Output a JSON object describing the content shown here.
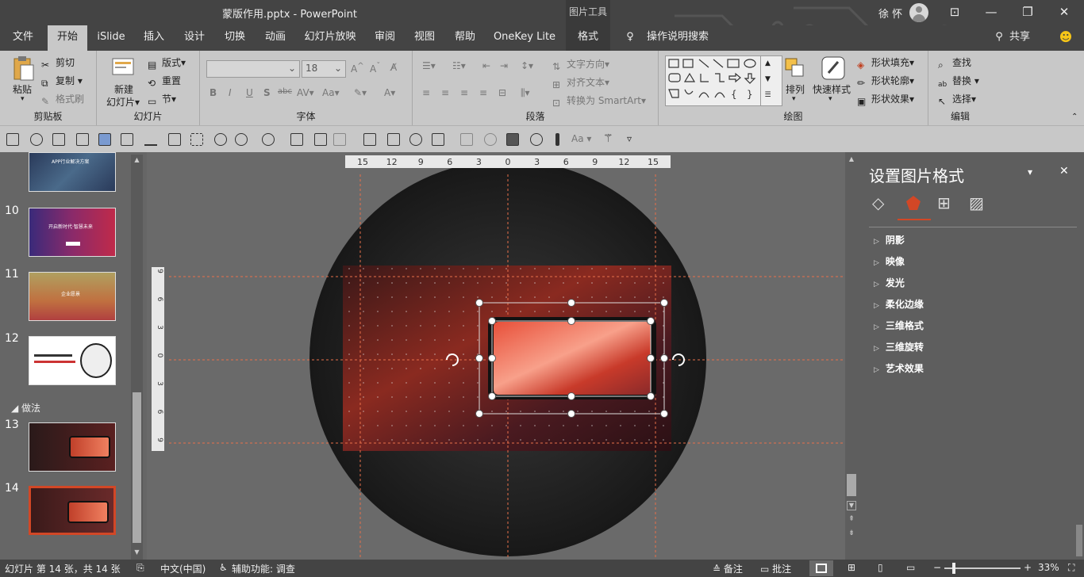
{
  "titlebar": {
    "title": "蒙版作用.pptx  -  PowerPoint",
    "context_tools": "图片工具",
    "user": "徐 怀",
    "restore_icon": "ribbon-display-options-icon",
    "minimize": "—",
    "maximize": "❐",
    "close": "✕"
  },
  "tabs": [
    "文件",
    "开始",
    "iSlide",
    "插入",
    "设计",
    "切换",
    "动画",
    "幻灯片放映",
    "审阅",
    "视图",
    "帮助",
    "OneKey Lite",
    "格式"
  ],
  "tell_me": "操作说明搜索",
  "share": "共享",
  "ribbon": {
    "clipboard": {
      "paste": "粘贴",
      "cut": "剪切",
      "copy": "复制",
      "format_painter": "格式刷",
      "label": "剪贴板"
    },
    "slides": {
      "new_slide_1": "新建",
      "new_slide_2": "幻灯片",
      "layout": "版式",
      "reset": "重置",
      "section": "节",
      "label": "幻灯片"
    },
    "font": {
      "font_name": "",
      "font_size": "18",
      "label": "字体"
    },
    "paragraph": {
      "text_direction": "文字方向",
      "align_text": "对齐文本",
      "convert_smartart": "转换为 SmartArt",
      "label": "段落"
    },
    "drawing": {
      "arrange": "排列",
      "quick_styles": "快速样式",
      "shape_fill": "形状填充",
      "shape_outline": "形状轮廓",
      "shape_effects": "形状效果",
      "label": "绘图"
    },
    "editing": {
      "find": "查找",
      "replace": "替换",
      "select": "选择",
      "label": "编辑"
    }
  },
  "slides_panel": {
    "numbers": [
      "10",
      "11",
      "12",
      "13",
      "14"
    ],
    "section": "做法",
    "thumb_texts": {
      "t9": "APP行业解决方案",
      "t10": "开启新时代·智慧未来",
      "t11": "企业愿景"
    }
  },
  "ruler": {
    "h_ticks": [
      "15",
      "12",
      "9",
      "6",
      "3",
      "0",
      "3",
      "6",
      "9",
      "12",
      "15"
    ],
    "v_ticks": [
      "9",
      "6",
      "3",
      "0",
      "3",
      "6",
      "9"
    ]
  },
  "format_pane": {
    "title": "设置图片格式",
    "items": [
      "阴影",
      "映像",
      "发光",
      "柔化边缘",
      "三维格式",
      "三维旋转",
      "艺术效果"
    ]
  },
  "status": {
    "slide_info": "幻灯片 第 14 张，共 14 张",
    "language": "中文(中国)",
    "accessibility": "辅助功能: 调查",
    "notes": "备注",
    "comments": "批注",
    "zoom": "33%"
  },
  "colors": {
    "accent": "#d24726",
    "guide": "#e8704a"
  }
}
